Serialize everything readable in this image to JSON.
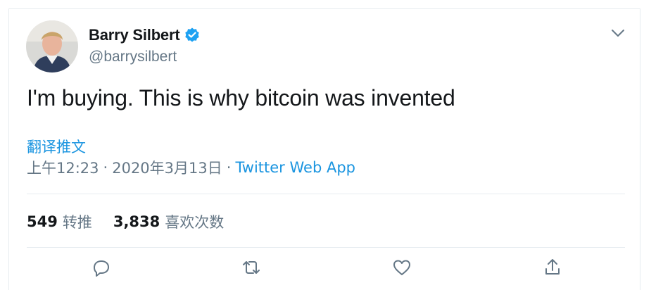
{
  "tweet": {
    "author_name": "Barry Silbert",
    "author_handle": "@barrysilbert",
    "verified_icon": "verified-badge-icon",
    "text": "I'm buying. This is why bitcoin was invented",
    "translate_label": "翻译推文",
    "time": "上午12:23",
    "date": "2020年3月13日",
    "separator": "·",
    "source_app": "Twitter Web App"
  },
  "stats": {
    "retweets_count": "549",
    "retweets_label": "转推",
    "likes_count": "3,838",
    "likes_label": "喜欢次数"
  },
  "actions": [
    "reply-icon",
    "retweet-icon",
    "like-icon",
    "share-icon"
  ],
  "colors": {
    "text": "#14171a",
    "secondary": "#657786",
    "link": "#1b95e0",
    "verified": "#1da1f2",
    "border": "#e6ecf0"
  }
}
